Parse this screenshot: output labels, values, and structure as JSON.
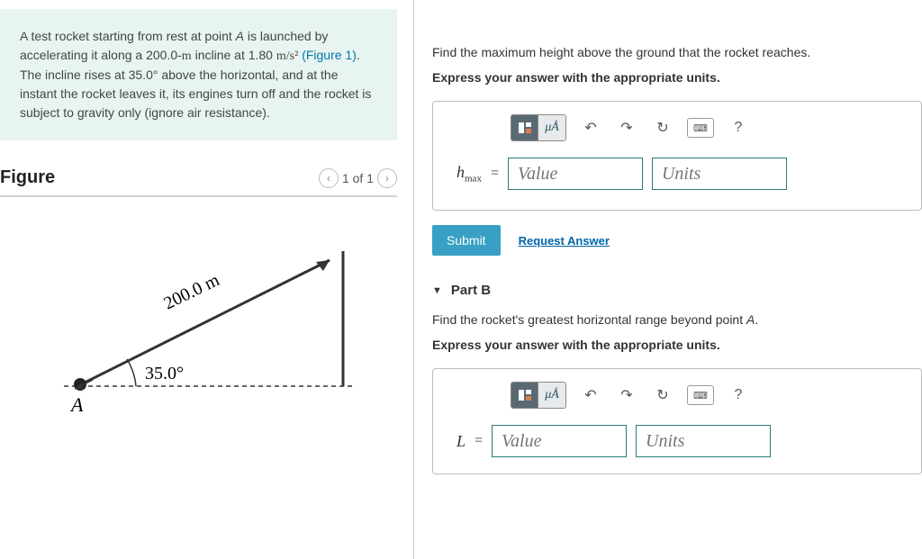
{
  "problem": {
    "text_before_figref": "A test rocket starting from rest at point ",
    "pointA": "A",
    "text_mid1": " is launched by accelerating it along a 200.0-",
    "unit_m": "m",
    "text_mid2": " incline at 1.80 ",
    "accel_units": "m/s²",
    "text_mid3": " ",
    "fig_ref": "(Figure 1)",
    "text_after": ". The incline rises at 35.0° above the horizontal, and at the instant the rocket leaves it, its engines turn off and the rocket is subject to gravity only (ignore air resistance)."
  },
  "figure": {
    "heading": "Figure",
    "nav": "1 of 1",
    "length_label": "200.0 m",
    "angle_label": "35.0°",
    "point_label": "A"
  },
  "partA": {
    "prompt": "Find the maximum height above the ground that the rocket reaches.",
    "instruction": "Express your answer with the appropriate units.",
    "var_html": "h",
    "var_sub": "max",
    "value_placeholder": "Value",
    "units_placeholder": "Units",
    "submit": "Submit",
    "request": "Request Answer"
  },
  "partB": {
    "title": "Part B",
    "prompt": "Find the rocket's greatest horizontal range beyond point ",
    "pointA": "A",
    "instruction": "Express your answer with the appropriate units.",
    "var_html": "L",
    "value_placeholder": "Value",
    "units_placeholder": "Units"
  },
  "toolbar": {
    "templates_icon": "templates-icon",
    "units_label": "μÅ",
    "undo": "↶",
    "redo": "↷",
    "reset": "↻",
    "keyboard": "⌨",
    "help": "?"
  }
}
